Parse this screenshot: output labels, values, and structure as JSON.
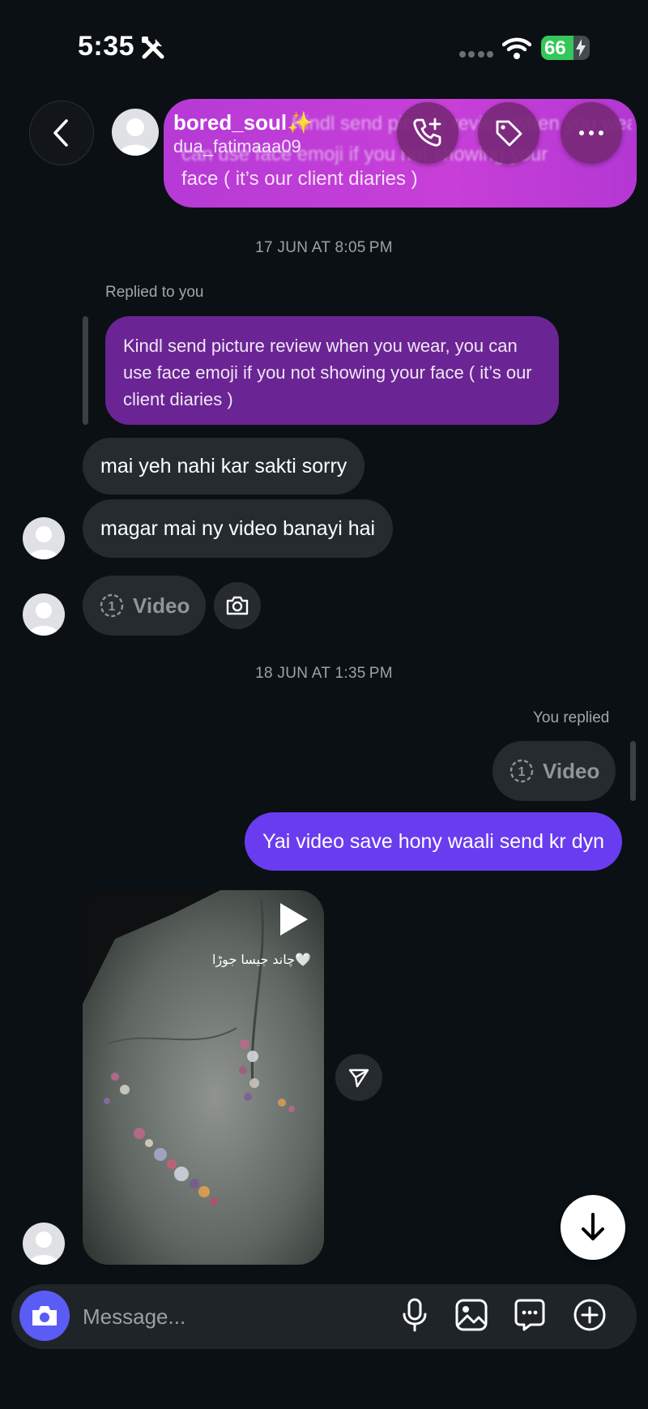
{
  "status_bar": {
    "time": "5:35",
    "battery": "66",
    "battery_level": 0.66
  },
  "pinned_preview": {
    "line1": "Kindl send picture review when you wear, you",
    "line2": "can use face emoji if you not showing your",
    "line3": "face ( it’s our client diaries )"
  },
  "header": {
    "name": "bored_soul",
    "name_emoji": "✨",
    "username": "dua_fatimaaa09"
  },
  "thread": {
    "timestamp1": "17 JUN AT 8:05 PM",
    "replied_label": "Replied to you",
    "replied_text": "Kindl send picture review when you wear, you can use face emoji if you not showing your face ( it’s our client diaries )",
    "msg1": "mai yeh nahi kar sakti sorry",
    "msg2": "magar mai ny video banayi hai",
    "video_label": "Video",
    "video_count": "1",
    "timestamp2": "18 JUN AT 1:35 PM",
    "you_replied_label": "You replied",
    "reply_video_label": "Video",
    "reply_video_count": "1",
    "sent_msg": "Yai video save hony waali send kr dyn",
    "reel_caption": "چاند جیسا جوڑا🤍"
  },
  "composer": {
    "placeholder": "Message..."
  },
  "colors": {
    "outgoing": "#6a3cf0",
    "pinned": "#c83fd8",
    "replied": "#6a2494",
    "incoming": "#262b30",
    "camera": "#5b5cf5",
    "battery": "#34c759"
  },
  "icons": [
    "tools-icon",
    "wifi-icon",
    "back-icon",
    "call-add-icon",
    "tag-icon",
    "more-icon",
    "camera-icon",
    "play-icon",
    "share-icon",
    "arrow-down-icon",
    "mic-icon",
    "gallery-icon",
    "sticker-icon",
    "plus-icon"
  ]
}
